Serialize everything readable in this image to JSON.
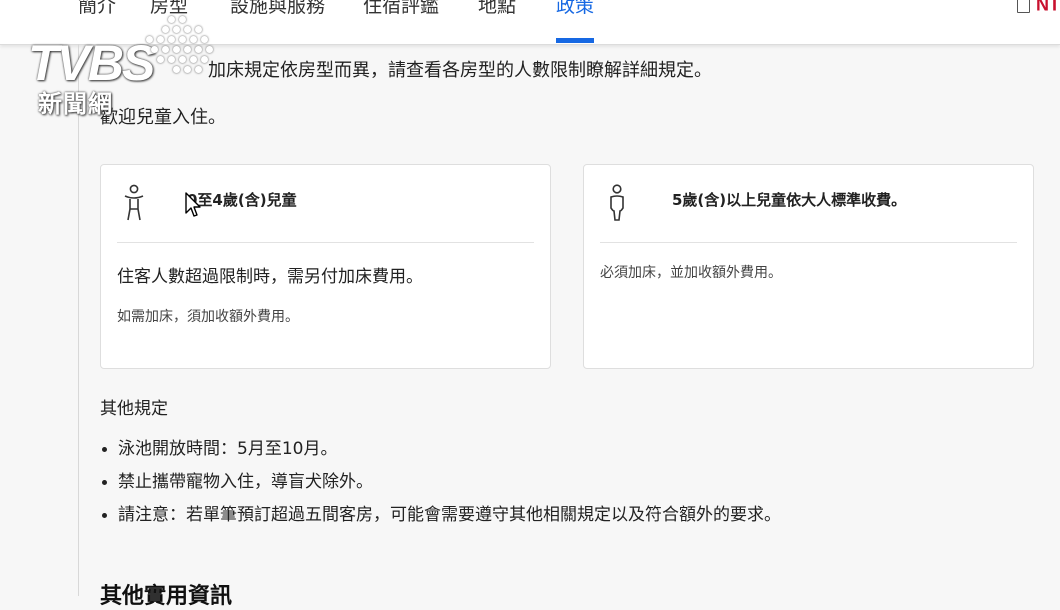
{
  "nav": {
    "tabs": [
      {
        "label": "簡介"
      },
      {
        "label": "房型"
      },
      {
        "label": "設施與服務"
      },
      {
        "label": "住宿評鑑"
      },
      {
        "label": "地點"
      },
      {
        "label": "政策"
      }
    ],
    "active_tab": "政策",
    "right_code": "NT"
  },
  "watermark": {
    "logo": "TVBS",
    "subtitle": "新聞網"
  },
  "policy": {
    "bed_rule_tail": "加床規定依房型而異，請查看各房型的人數限制瞭解詳細規定。",
    "children_welcome": "歡迎兒童入住。"
  },
  "cards": [
    {
      "icon": "child-icon",
      "title": "0至4歲(含)兒童",
      "main": "住客人數超過限制時，需另付加床費用。",
      "sub": "如需加床，須加收額外費用。"
    },
    {
      "icon": "person-icon",
      "title": "5歲(含)以上兒童依大人標準收費。",
      "main": "",
      "sub": "必須加床，並加收額外費用。"
    }
  ],
  "other_rules": {
    "title": "其他規定",
    "items": [
      "泳池開放時間：5月至10月。",
      "禁止攜帶寵物入住，導盲犬除外。",
      "請注意：若單筆預訂超過五間客房，可能會需要遵守其他相關規定以及符合額外的要求。"
    ]
  },
  "bottom_section_title": "其他實用資訊",
  "colors": {
    "accent": "#1668e3",
    "code_red": "#c8102e",
    "background": "#f7f7f7"
  }
}
